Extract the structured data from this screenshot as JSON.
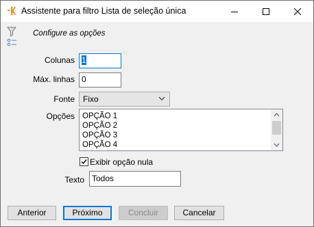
{
  "window": {
    "title": "Assistente para filtro Lista de seleção única",
    "controls": {
      "minimize": "minimize-icon",
      "maximize": "maximize-icon",
      "close": "close-icon"
    }
  },
  "header": {
    "caption": "Configure as opções"
  },
  "form": {
    "columns": {
      "label": "Colunas",
      "value": "1"
    },
    "max_lines": {
      "label": "Máx. linhas",
      "value": "0"
    },
    "font": {
      "label": "Fonte",
      "value": "Fixo"
    },
    "options": {
      "label": "Opções",
      "items": [
        "OPÇÃO 1",
        "OPÇÃO 2",
        "OPÇÃO 3",
        "OPÇÃO 4"
      ]
    },
    "show_null": {
      "label": "Exibir opção nula",
      "checked": true
    },
    "text": {
      "label": "Texto",
      "value": "Todos"
    }
  },
  "footer": {
    "back": "Anterior",
    "next": "Próximo",
    "finish": "Concluir",
    "cancel": "Cancelar"
  },
  "colors": {
    "accent": "#0078d7",
    "app_icon": "#f28c28"
  }
}
